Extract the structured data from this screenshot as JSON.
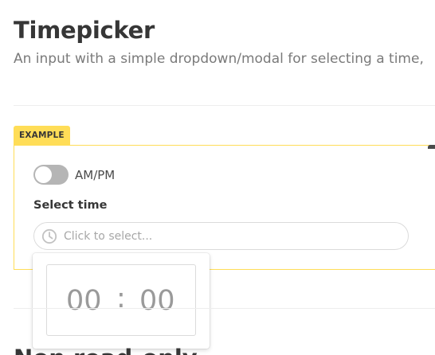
{
  "header": {
    "title": "Timepicker",
    "subtitle": "An input with a simple dropdown/modal for selecting a time,"
  },
  "example": {
    "tag": "EXAMPLE",
    "toggle": {
      "label": "AM/PM",
      "checked": false
    },
    "field": {
      "label": "Select time",
      "placeholder": "Click to select...",
      "icon": "clock-icon"
    },
    "picker": {
      "hours": "00",
      "separator": ":",
      "minutes": "00"
    }
  },
  "next_section": {
    "title": "Non read-only"
  },
  "colors": {
    "accent": "#ffdd57",
    "toggle_off": "#b5b5b5",
    "text": "#363636",
    "muted": "#7a7a7a"
  }
}
